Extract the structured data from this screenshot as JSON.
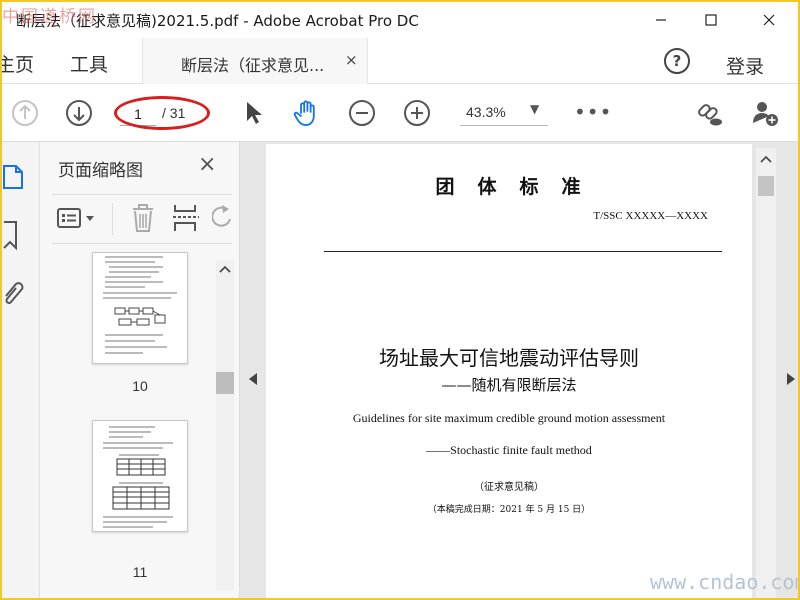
{
  "watermark": {
    "site_cn": "中国道桥网",
    "site_url": "www.cndao.com"
  },
  "window": {
    "title": "断层法（征求意见稿)2021.5.pdf - Adobe Acrobat Pro DC",
    "controls": [
      "minimize",
      "maximize",
      "close"
    ]
  },
  "tabs": {
    "home": "主页",
    "tools": "工具",
    "document": "断层法（征求意见...",
    "close": "×"
  },
  "header": {
    "help": "?",
    "login": "登录"
  },
  "toolbar": {
    "page_current": "1",
    "page_total": "/ 31",
    "zoom": "43.3%",
    "more": "•••"
  },
  "icons": {
    "prev_page": "arrow-up-circle-icon",
    "next_page": "arrow-down-circle-icon",
    "select": "cursor-icon",
    "hand": "hand-icon",
    "zoom_out": "zoom-out-icon",
    "zoom_in": "zoom-in-icon",
    "share_link": "link-icon",
    "add_user": "add-user-icon"
  },
  "thumbnails_panel": {
    "title": "页面缩略图",
    "close": "×",
    "items": [
      {
        "page": "10"
      },
      {
        "page": "11"
      }
    ]
  },
  "document": {
    "org_title": "团　体　标　准",
    "code": "T/SSC XXXXX—XXXX",
    "title_cn": "场址最大可信地震动评估导则",
    "subtitle_cn": "——随机有限断层法",
    "title_en": "Guidelines for site maximum credible ground motion assessment",
    "subtitle_en": "——Stochastic finite fault method",
    "draft_note": "（征求意见稿）",
    "date_note": "（本稿完成日期：2021 年 5 月 15 日）"
  },
  "colors": {
    "accent": "#1473e6",
    "highlight_ellipse": "#d81e1e",
    "frame": "#f0c828"
  }
}
